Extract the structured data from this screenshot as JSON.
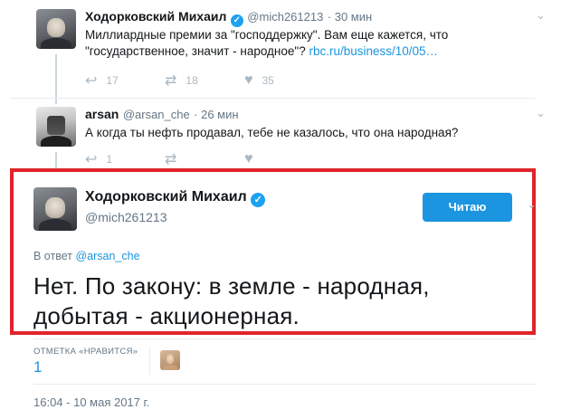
{
  "tweet1": {
    "name": "Ходорковский Михаил",
    "handle": "@mich261213",
    "time": "· 30 мин",
    "text_line1": "Миллиардные премии за \"господдержку\". Вам еще кажется, что",
    "text_line2": "\"государственное, значит - народное\"?",
    "link": "rbc.ru/business/10/05…",
    "replies": "17",
    "retweets": "18",
    "likes": "35"
  },
  "tweet2": {
    "name": "arsan",
    "handle": "@arsan_che",
    "time": "· 26 мин",
    "text": "А когда ты нефть продавал, тебе не казалось, что она народная?",
    "replies": "1",
    "retweets": "",
    "likes": ""
  },
  "main_tweet": {
    "name": "Ходорковский Михаил",
    "handle": "@mich261213",
    "follow_label": "Читаю",
    "reply_prefix": "В ответ",
    "reply_handle": "@arsan_che",
    "text_line1": "Нет. По закону: в земле - народная,",
    "text_line2": "добытая - акционерная.",
    "likes_label": "ОТМЕТКА «НРАВИТСЯ»",
    "likes_count": "1",
    "timestamp": "16:04 - 10 мая 2017 г."
  },
  "icons": {
    "reply": "reply-icon",
    "retweet": "retweet-icon",
    "like": "heart-icon",
    "verified": "verified-icon",
    "more": "chevron-down-icon"
  },
  "colors": {
    "accent": "#1b95e0",
    "highlight_border": "#e0242a",
    "muted": "#657786"
  }
}
